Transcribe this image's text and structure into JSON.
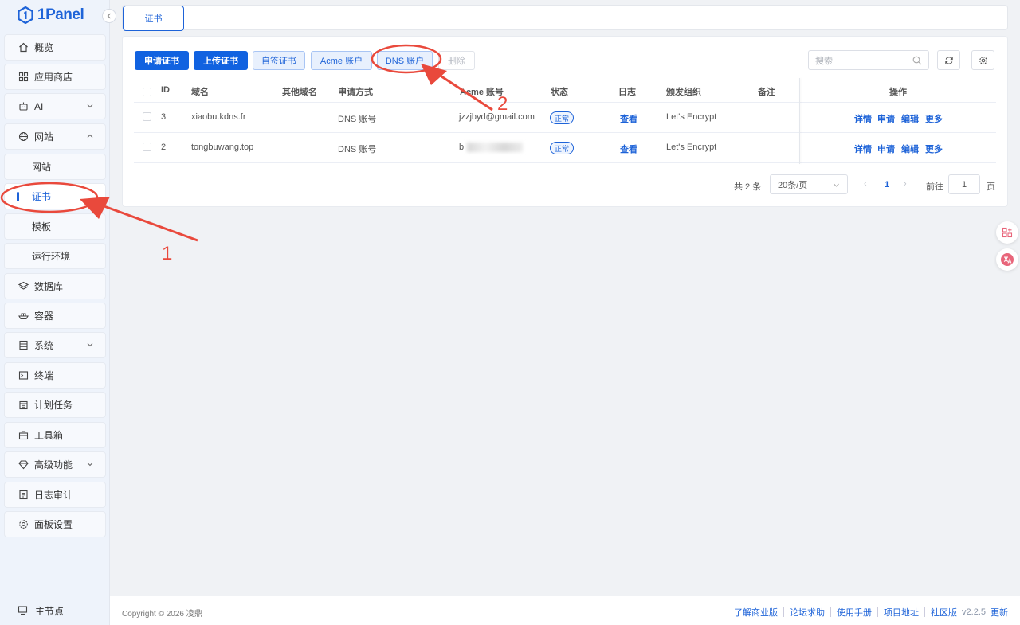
{
  "app": {
    "logo_text": "1Panel"
  },
  "sidebar": {
    "items": [
      {
        "label": "概览",
        "icon": "home-icon"
      },
      {
        "label": "应用商店",
        "icon": "apps-icon"
      },
      {
        "label": "AI",
        "icon": "robot-icon"
      },
      {
        "label": "网站",
        "icon": "globe-icon"
      },
      {
        "label": "数据库",
        "icon": "layers-icon"
      },
      {
        "label": "容器",
        "icon": "ship-icon"
      },
      {
        "label": "系统",
        "icon": "server-icon"
      },
      {
        "label": "终端",
        "icon": "terminal-icon"
      },
      {
        "label": "计划任务",
        "icon": "calendar-icon"
      },
      {
        "label": "工具箱",
        "icon": "toolbox-icon"
      },
      {
        "label": "高级功能",
        "icon": "diamond-icon"
      },
      {
        "label": "日志审计",
        "icon": "log-icon"
      },
      {
        "label": "面板设置",
        "icon": "gear-icon"
      }
    ],
    "website_sub": [
      {
        "label": "网站"
      },
      {
        "label": "证书"
      },
      {
        "label": "模板"
      },
      {
        "label": "运行环境"
      }
    ],
    "node_label": "主节点"
  },
  "tabs": {
    "active_label": "证书"
  },
  "toolbar": {
    "apply_cert": "申请证书",
    "upload_cert": "上传证书",
    "self_signed": "自签证书",
    "acme_account": "Acme 账户",
    "dns_account": "DNS 账户",
    "delete": "删除",
    "search_placeholder": "搜索"
  },
  "table": {
    "headers": {
      "id": "ID",
      "domain": "域名",
      "other_domain": "其他域名",
      "method": "申请方式",
      "acme": "Acme 账号",
      "status": "状态",
      "log": "日志",
      "issuer": "颁发组织",
      "remark": "备注",
      "ops": "操作"
    },
    "rows": [
      {
        "id": "3",
        "domain": "xiaobu.kdns.fr",
        "method": "DNS 账号",
        "acme": "jzzjbyd@gmail.com",
        "status": "正常",
        "log": "查看",
        "issuer": "Let's Encrypt"
      },
      {
        "id": "2",
        "domain": "tongbuwang.top",
        "method": "DNS 账号",
        "acme": "b",
        "status": "正常",
        "log": "查看",
        "issuer": "Let's Encrypt"
      }
    ],
    "ops": {
      "detail": "详情",
      "apply": "申请",
      "edit": "编辑",
      "more": "更多"
    }
  },
  "pagination": {
    "total": "共 2 条",
    "page_size": "20条/页",
    "current_page": "1",
    "goto_label": "前往",
    "goto_value": "1",
    "page_suffix": "页"
  },
  "footer": {
    "copyright": "Copyright © 2026 凌鼎",
    "links": [
      "了解商业版",
      "论坛求助",
      "使用手册",
      "项目地址",
      "社区版"
    ],
    "version": "v2.2.5",
    "update": "更新"
  },
  "annotations": {
    "label_1": "1",
    "label_2": "2",
    "color": "#e9493c"
  },
  "colors": {
    "primary": "#1162e0",
    "link": "#1e63d8"
  }
}
